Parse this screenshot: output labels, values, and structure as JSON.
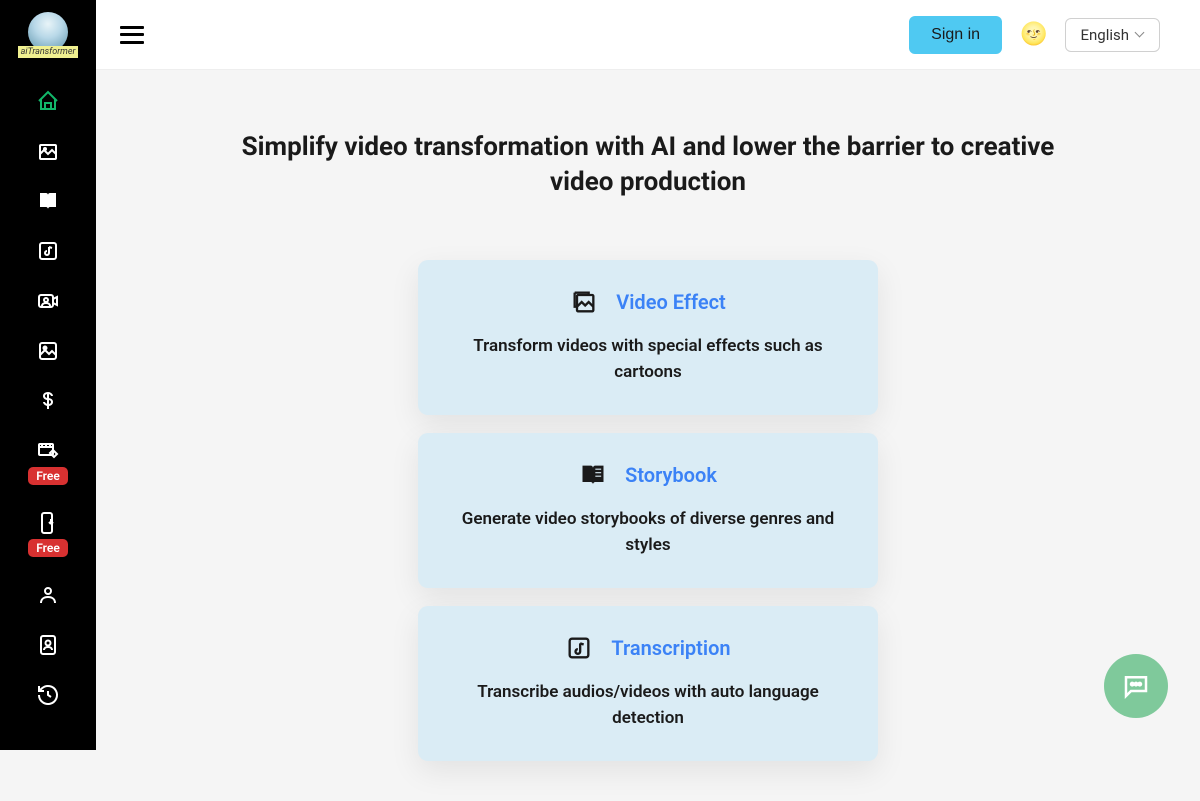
{
  "brand": {
    "name": "aiTransformer"
  },
  "header": {
    "signin_label": "Sign in",
    "language": "English"
  },
  "sidebar": {
    "free_badge": "Free",
    "items": [
      {
        "name": "home",
        "active": true
      },
      {
        "name": "image-gallery"
      },
      {
        "name": "book"
      },
      {
        "name": "music-note"
      },
      {
        "name": "video-person"
      },
      {
        "name": "image"
      },
      {
        "name": "pricing"
      },
      {
        "name": "video-edit",
        "free": true
      },
      {
        "name": "phone-download",
        "free": true
      },
      {
        "name": "user"
      },
      {
        "name": "user-badge"
      },
      {
        "name": "history"
      }
    ]
  },
  "hero": {
    "title": "Simplify video transformation with AI and lower the barrier to creative video production"
  },
  "cards": [
    {
      "icon": "image-effect",
      "title": "Video Effect",
      "desc": "Transform videos with special effects such as cartoons"
    },
    {
      "icon": "storybook",
      "title": "Storybook",
      "desc": "Generate video storybooks of diverse genres and styles"
    },
    {
      "icon": "transcription",
      "title": "Transcription",
      "desc": "Transcribe audios/videos with auto language detection"
    }
  ]
}
